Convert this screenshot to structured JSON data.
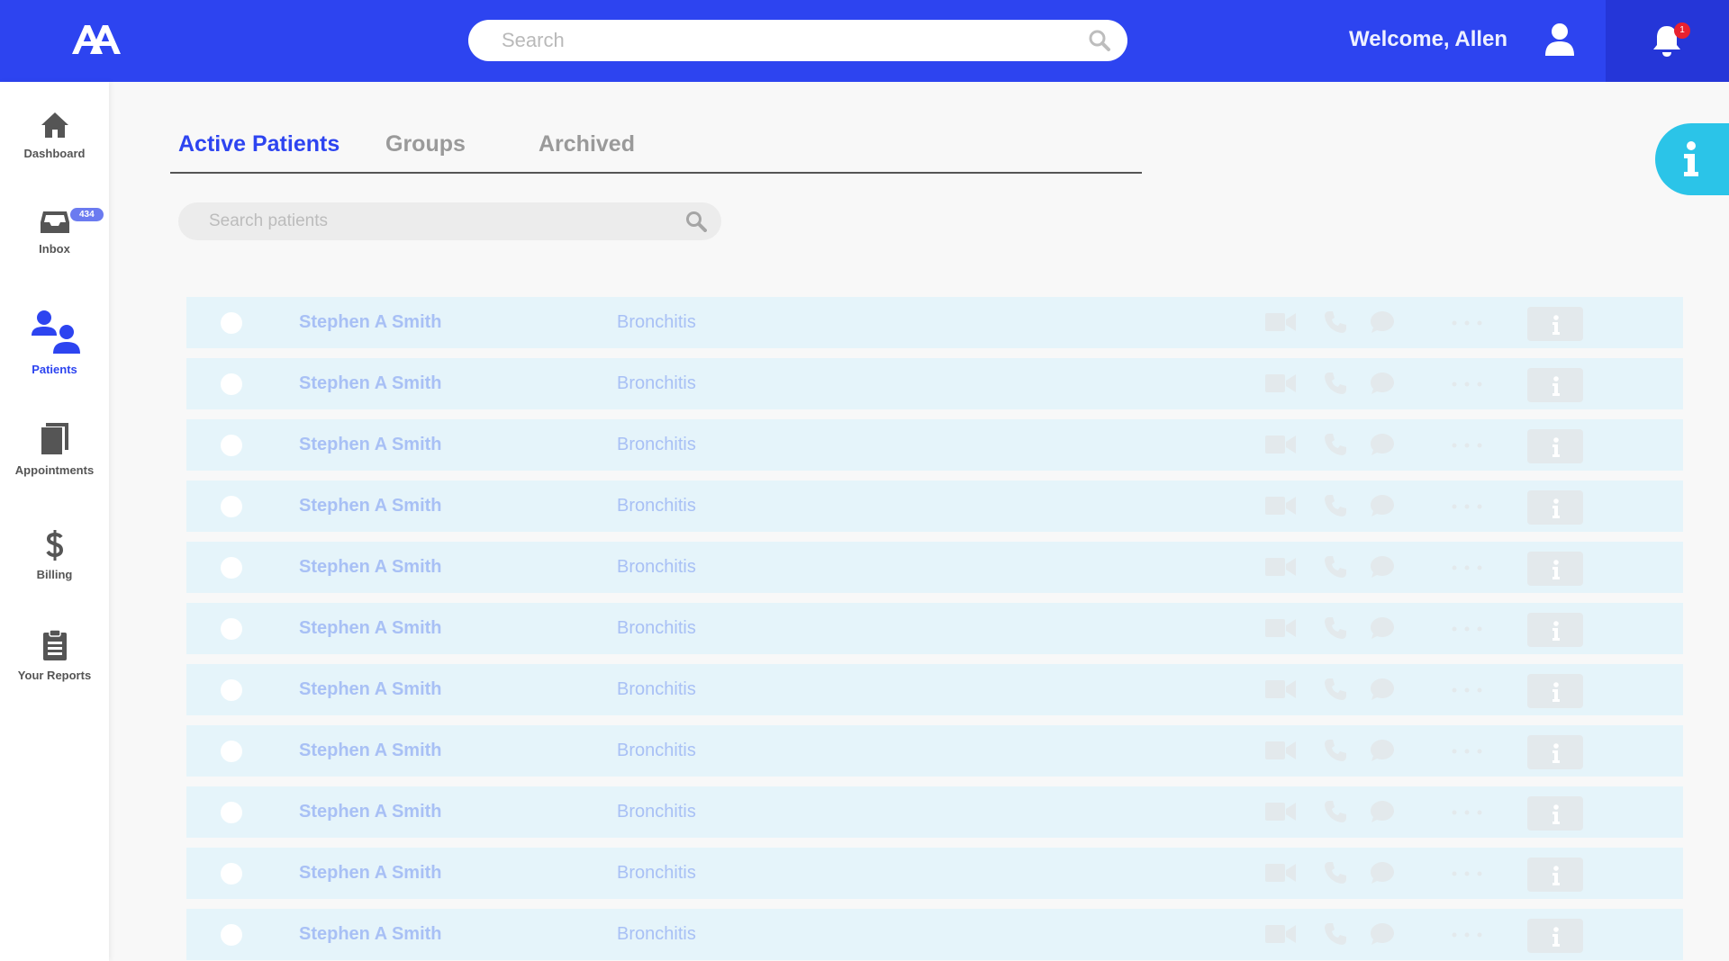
{
  "header": {
    "search_placeholder": "Search",
    "welcome": "Welcome, Allen",
    "notification_count": "1"
  },
  "sidebar": {
    "items": [
      {
        "label": "Dashboard",
        "icon": "home-icon"
      },
      {
        "label": "Inbox",
        "icon": "inbox-icon",
        "badge": "434"
      },
      {
        "label": "Patients",
        "icon": "patients-icon",
        "active": true
      },
      {
        "label": "Appointments",
        "icon": "book-icon"
      },
      {
        "label": "Billing",
        "icon": "dollar-icon"
      },
      {
        "label": "Your Reports",
        "icon": "clipboard-icon"
      }
    ]
  },
  "tabs": [
    {
      "label": "Active Patients",
      "active": true
    },
    {
      "label": "Groups"
    },
    {
      "label": "Archived"
    }
  ],
  "patient_search": {
    "placeholder": "Search patients"
  },
  "patients": [
    {
      "name": "Stephen A Smith",
      "condition": "Bronchitis"
    },
    {
      "name": "Stephen A Smith",
      "condition": "Bronchitis"
    },
    {
      "name": "Stephen A Smith",
      "condition": "Bronchitis"
    },
    {
      "name": "Stephen A Smith",
      "condition": "Bronchitis"
    },
    {
      "name": "Stephen A Smith",
      "condition": "Bronchitis"
    },
    {
      "name": "Stephen A Smith",
      "condition": "Bronchitis"
    },
    {
      "name": "Stephen A Smith",
      "condition": "Bronchitis"
    },
    {
      "name": "Stephen A Smith",
      "condition": "Bronchitis"
    },
    {
      "name": "Stephen A Smith",
      "condition": "Bronchitis"
    },
    {
      "name": "Stephen A Smith",
      "condition": "Bronchitis"
    },
    {
      "name": "Stephen A Smith",
      "condition": "Bronchitis"
    }
  ],
  "colors": {
    "primary": "#2d44f0",
    "row_bg": "#e5f4fa",
    "info_accent": "#2bc4e8",
    "badge_red": "#e8212f"
  }
}
